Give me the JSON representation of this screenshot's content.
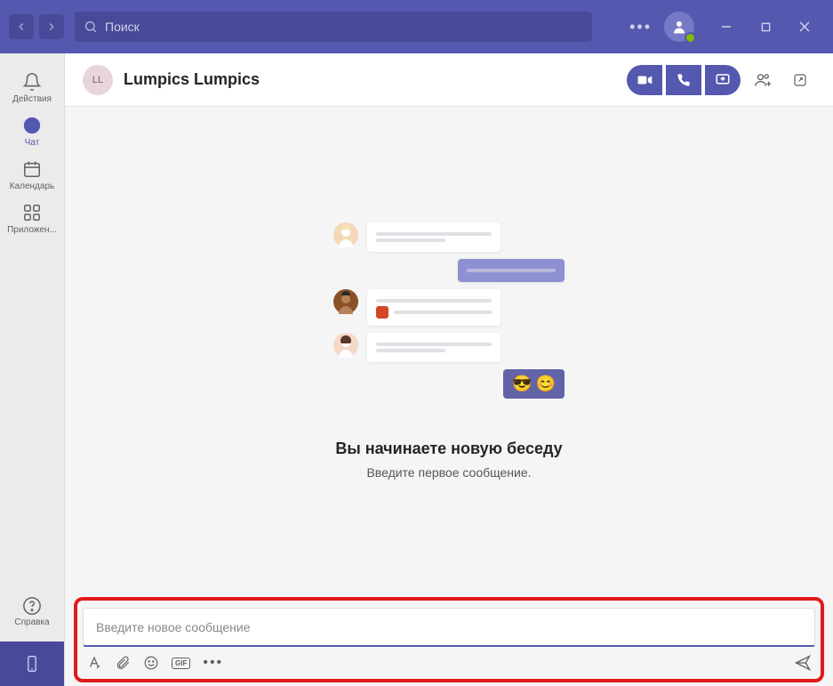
{
  "search": {
    "placeholder": "Поиск"
  },
  "rail": {
    "items": [
      {
        "label": "Действия"
      },
      {
        "label": "Чат"
      },
      {
        "label": "Календарь"
      },
      {
        "label": "Приложен..."
      }
    ],
    "help": "Справка"
  },
  "chat": {
    "avatar_initials": "LL",
    "title": "Lumpics Lumpics"
  },
  "empty": {
    "title": "Вы начинаете новую беседу",
    "subtitle": "Введите первое сообщение."
  },
  "compose": {
    "placeholder": "Введите новое сообщение",
    "gif_label": "GIF"
  }
}
